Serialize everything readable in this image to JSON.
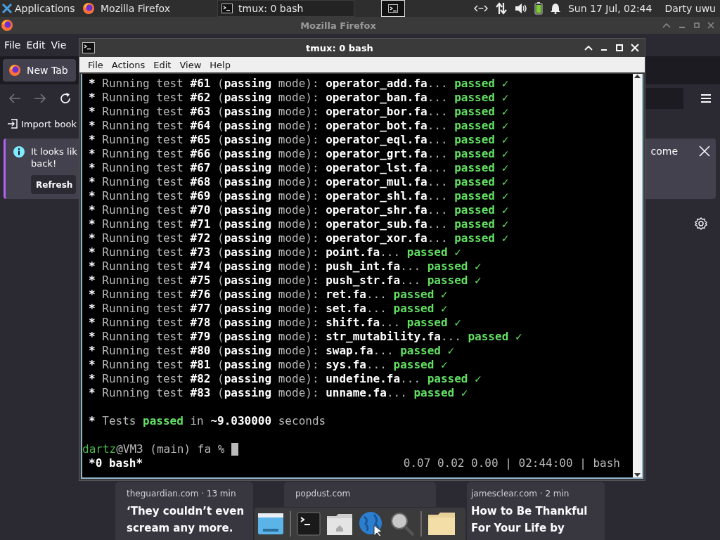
{
  "top_panel": {
    "app_menu": "Applications",
    "tasks": [
      {
        "title": "Mozilla Firefox",
        "kind": "browser",
        "selected": false
      },
      {
        "title": "tmux: 0 bash",
        "kind": "terminal",
        "selected": true
      }
    ],
    "clock": "Sun 17 Jul, 02:44",
    "user": "Darty uwu"
  },
  "firefox": {
    "title": "Mozilla Firefox",
    "menu": [
      "File",
      "Edit",
      "Vie"
    ],
    "tab": "New Tab",
    "bookmark": "Import book",
    "notification": {
      "text_start": "It looks lik",
      "text_second": "back!",
      "text_end": "come",
      "button": "Refresh"
    },
    "stories": [
      {
        "source": "theguardian.com · 13 min",
        "headline": [
          "‘They couldn’t even",
          "scream any more."
        ]
      },
      {
        "source": "popdust.com"
      },
      {
        "source": "jamesclear.com · 2 min",
        "headline": [
          "How to Be Thankful",
          "For Your Life by"
        ]
      }
    ]
  },
  "terminal": {
    "title": "tmux: 0 bash",
    "menu": [
      "File",
      "Actions",
      "Edit",
      "View",
      "Help"
    ],
    "lines": [
      {
        "bullet": "*",
        "text": "Running test **#61** (**passing** mode): **operator_add.fa**...",
        "status": "passed",
        "mark": "✓"
      },
      {
        "bullet": "*",
        "text": "Running test **#62** (**passing** mode): **operator_ban.fa**...",
        "status": "passed",
        "mark": "✓"
      },
      {
        "bullet": "*",
        "text": "Running test **#63** (**passing** mode): **operator_bor.fa**...",
        "status": "passed",
        "mark": "✓"
      },
      {
        "bullet": "*",
        "text": "Running test **#64** (**passing** mode): **operator_bot.fa**...",
        "status": "passed",
        "mark": "✓"
      },
      {
        "bullet": "*",
        "text": "Running test **#65** (**passing** mode): **operator_eql.fa**...",
        "status": "passed",
        "mark": "✓"
      },
      {
        "bullet": "*",
        "text": "Running test **#66** (**passing** mode): **operator_grt.fa**...",
        "status": "passed",
        "mark": "✓"
      },
      {
        "bullet": "*",
        "text": "Running test **#67** (**passing** mode): **operator_lst.fa**...",
        "status": "passed",
        "mark": "✓"
      },
      {
        "bullet": "*",
        "text": "Running test **#68** (**passing** mode): **operator_mul.fa**...",
        "status": "passed",
        "mark": "✓"
      },
      {
        "bullet": "*",
        "text": "Running test **#69** (**passing** mode): **operator_shl.fa**...",
        "status": "passed",
        "mark": "✓"
      },
      {
        "bullet": "*",
        "text": "Running test **#70** (**passing** mode): **operator_shr.fa**...",
        "status": "passed",
        "mark": "✓"
      },
      {
        "bullet": "*",
        "text": "Running test **#71** (**passing** mode): **operator_sub.fa**...",
        "status": "passed",
        "mark": "✓"
      },
      {
        "bullet": "*",
        "text": "Running test **#72** (**passing** mode): **operator_xor.fa**...",
        "status": "passed",
        "mark": "✓"
      },
      {
        "bullet": "*",
        "text": "Running test **#73** (**passing** mode): **point.fa**...",
        "status": "passed",
        "mark": "✓"
      },
      {
        "bullet": "*",
        "text": "Running test **#74** (**passing** mode): **push_int.fa**...",
        "status": "passed",
        "mark": "✓"
      },
      {
        "bullet": "*",
        "text": "Running test **#75** (**passing** mode): **push_str.fa**...",
        "status": "passed",
        "mark": "✓"
      },
      {
        "bullet": "*",
        "text": "Running test **#76** (**passing** mode): **ret.fa**...",
        "status": "passed",
        "mark": "✓"
      },
      {
        "bullet": "*",
        "text": "Running test **#77** (**passing** mode): **set.fa**...",
        "status": "passed",
        "mark": "✓"
      },
      {
        "bullet": "*",
        "text": "Running test **#78** (**passing** mode): **shift.fa**...",
        "status": "passed",
        "mark": "✓"
      },
      {
        "bullet": "*",
        "text": "Running test **#79** (**passing** mode): **str_mutability.fa**...",
        "status": "passed",
        "mark": "✓"
      },
      {
        "bullet": "*",
        "text": "Running test **#80** (**passing** mode): **swap.fa**...",
        "status": "passed",
        "mark": "✓"
      },
      {
        "bullet": "*",
        "text": "Running test **#81** (**passing** mode): **sys.fa**...",
        "status": "passed",
        "mark": "✓"
      },
      {
        "bullet": "*",
        "text": "Running test **#82** (**passing** mode): **undefine.fa**...",
        "status": "passed",
        "mark": "✓"
      },
      {
        "bullet": "*",
        "text": "Running test **#83** (**passing** mode): **unname.fa**...",
        "status": "passed",
        "mark": "✓"
      }
    ],
    "summary": {
      "bullet": "*",
      "lead": "Tests",
      "status": "passed",
      "tail": "in **~9.030000** seconds"
    },
    "prompt": {
      "user": "dartz",
      "rest": "@VM3 (main) fa %"
    },
    "status_left": "*0 bash*",
    "status_right": "0.07 0.02 0.00 | 02:44:00 | bash"
  },
  "dock": [
    {
      "kind": "desktop"
    },
    {
      "kind": "separator"
    },
    {
      "kind": "terminal"
    },
    {
      "kind": "home"
    },
    {
      "kind": "globe"
    },
    {
      "kind": "search"
    },
    {
      "kind": "separator"
    },
    {
      "kind": "folder"
    }
  ]
}
